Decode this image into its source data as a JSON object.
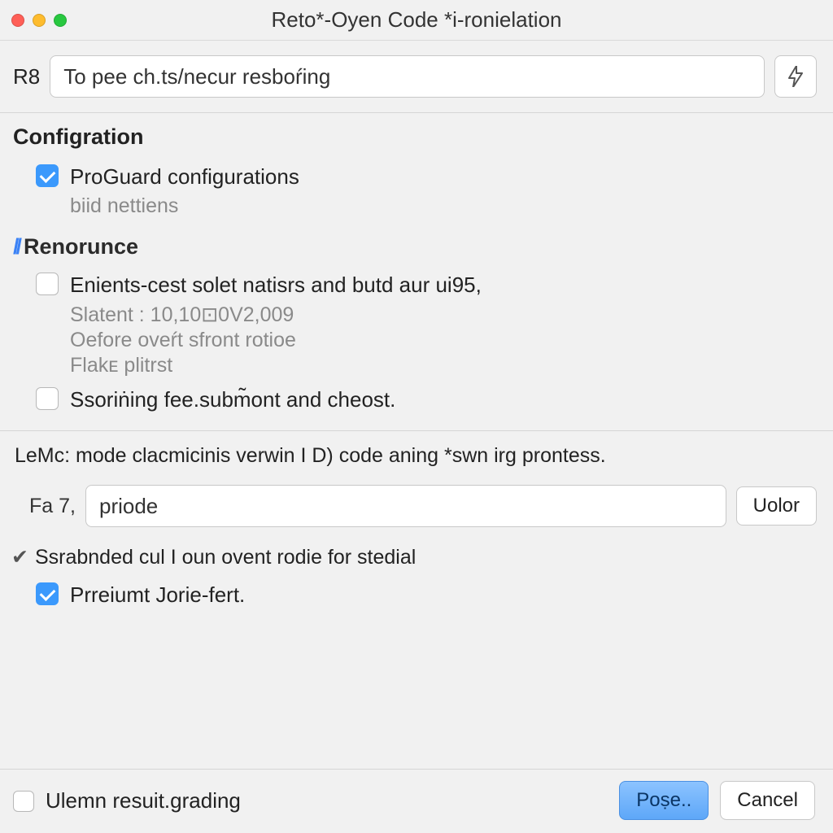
{
  "titlebar": {
    "title": "Reto*-Oyen Code *i-ronielation"
  },
  "toolbar": {
    "label": "R8",
    "input_value": "To pee ch.ts/necur resboŕing",
    "lightning_icon": "lightning"
  },
  "configuration": {
    "heading": "Configration",
    "proguard": {
      "label": "ProGuard configurations",
      "checked": true,
      "sub": "biid nettiens"
    }
  },
  "renorunce": {
    "heading": "Renorunce",
    "opt1": {
      "label": "Enients-cest solet natisrs and butd aur ui95,",
      "checked": false
    },
    "sub_slatent": "Slatent : 10,10⊡0V2,009",
    "sub_oefore": "Oefore oveŕt sfront rotioe",
    "sub_flake": "Flakᴇ plitrst",
    "opt2": {
      "label": "Ssoriṅing fee.subm̃ont and cheost.",
      "checked": false
    }
  },
  "lemc_paragraph": "LeMc: mode clacmicinis verwin I D) code aning *swn irg prontess.",
  "fa_row": {
    "label": "Fa 7,",
    "input_value": "priode",
    "button": "Uolor"
  },
  "ssrabnded": {
    "label": "Ssrabnded cul I oun ovent rodie for stedial"
  },
  "preiumt": {
    "label": "Prreiumt Jorie-fert.",
    "checked": true
  },
  "footer": {
    "checkbox_checked": false,
    "label": "Ulemn resuit.grading",
    "primary": "Poṣe..",
    "cancel": "Cancel"
  }
}
